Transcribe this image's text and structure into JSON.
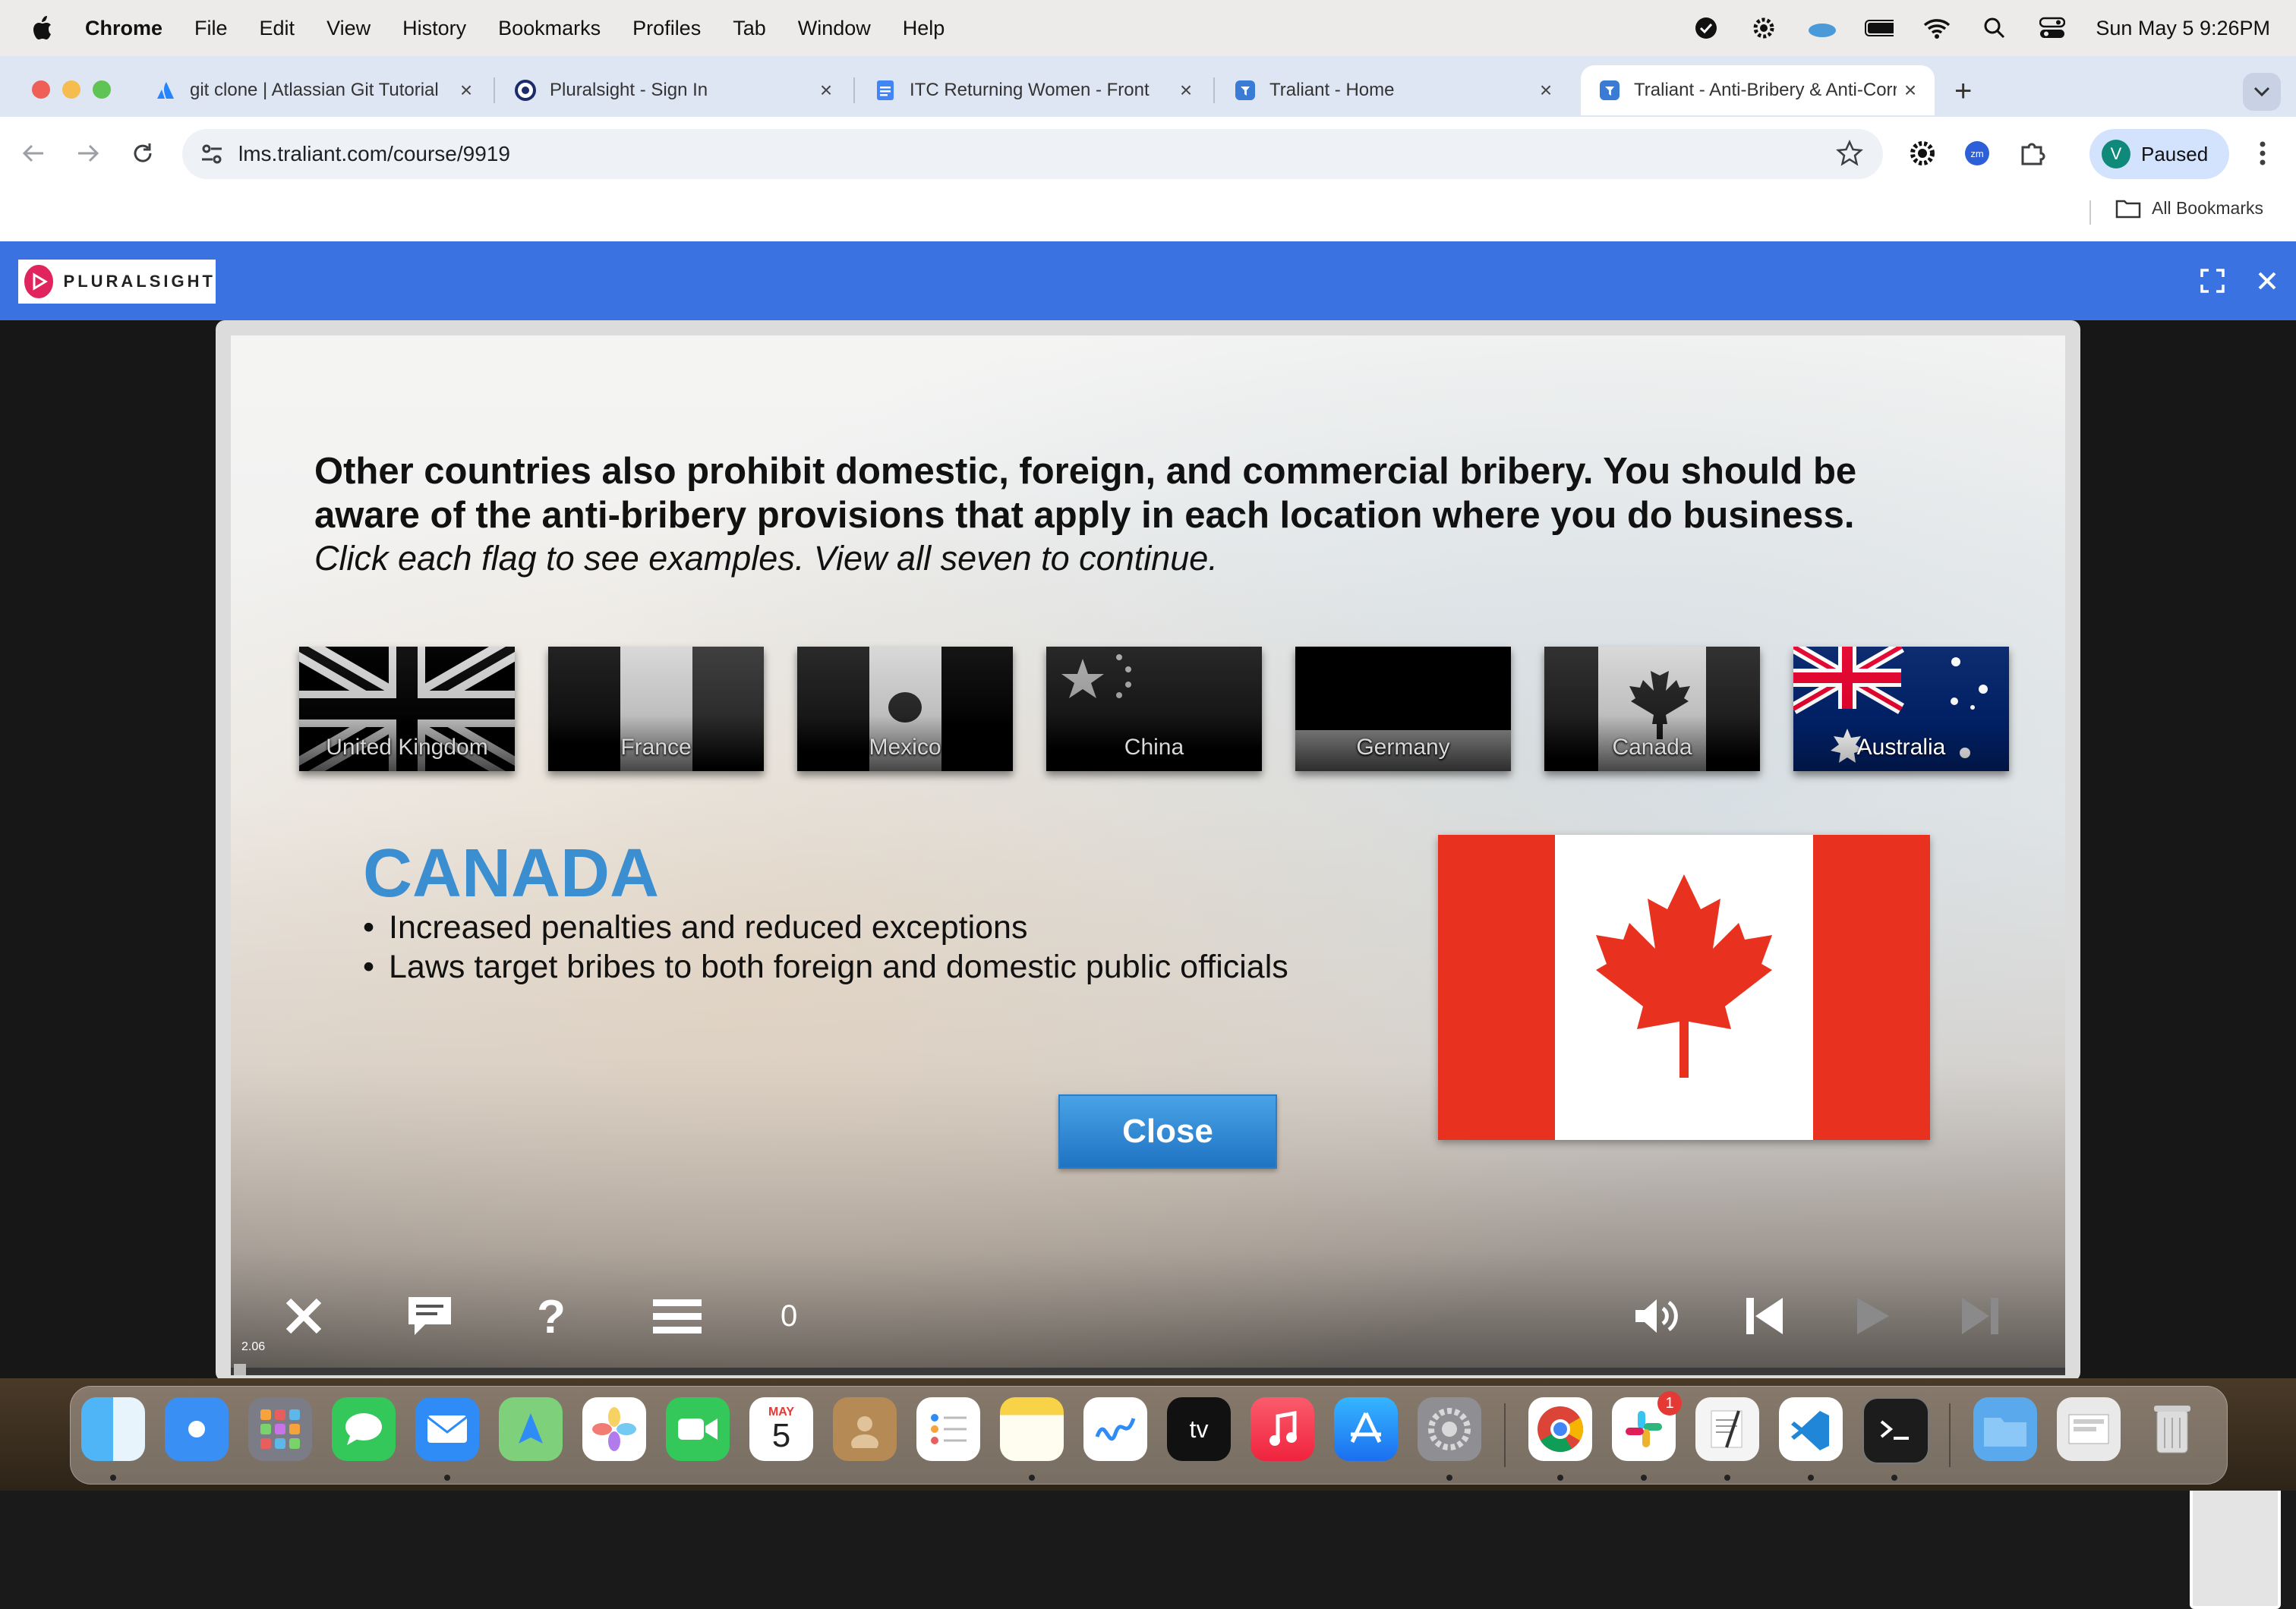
{
  "menubar": {
    "app_name": "Chrome",
    "items": [
      "File",
      "Edit",
      "View",
      "History",
      "Bookmarks",
      "Profiles",
      "Tab",
      "Window",
      "Help"
    ],
    "clock": "Sun May 5  9:26PM"
  },
  "tabs": [
    {
      "title": "git clone | Atlassian Git Tutorial",
      "icon": "atlassian-icon"
    },
    {
      "title": "Pluralsight - Sign In",
      "icon": "pluralsight-icon"
    },
    {
      "title": "ITC Returning Women - Front",
      "icon": "google-docs-icon"
    },
    {
      "title": "Traliant - Home",
      "icon": "traliant-icon"
    },
    {
      "title": "Traliant - Anti-Bribery & Anti-Corruption",
      "icon": "traliant-icon",
      "active": true
    }
  ],
  "toolbar": {
    "url": "lms.traliant.com/course/9919",
    "profile_initial": "V",
    "profile_label": "Paused"
  },
  "bookmarks": {
    "all_label": "All Bookmarks"
  },
  "player": {
    "brand": "PLURALSIGHT",
    "heading": "Other countries also prohibit domestic, foreign, and commercial bribery. You should be aware of the anti-bribery provisions that apply in each location where you do business.",
    "instructions": "Click each flag to see examples. View all seven to continue.",
    "flags": [
      {
        "label": "United Kingdom",
        "viewed": true
      },
      {
        "label": "France",
        "viewed": true
      },
      {
        "label": "Mexico",
        "viewed": true
      },
      {
        "label": "China",
        "viewed": true
      },
      {
        "label": "Germany",
        "viewed": true
      },
      {
        "label": "Canada",
        "viewed": true
      },
      {
        "label": "Australia",
        "viewed": false
      }
    ],
    "detail": {
      "country": "CANADA",
      "bullets": [
        "Increased penalties and reduced exceptions",
        "Laws target bribes to both foreign and domestic public officials"
      ],
      "close_label": "Close"
    },
    "controls": {
      "counter": "0",
      "time": "2.06"
    }
  },
  "dock": {
    "badge_count": "1",
    "calendar_month": "MAY",
    "calendar_day": "5"
  },
  "colors": {
    "header_blue": "#3a72e2",
    "title_blue": "#3b8fd1",
    "canada_red": "#e8321f"
  }
}
